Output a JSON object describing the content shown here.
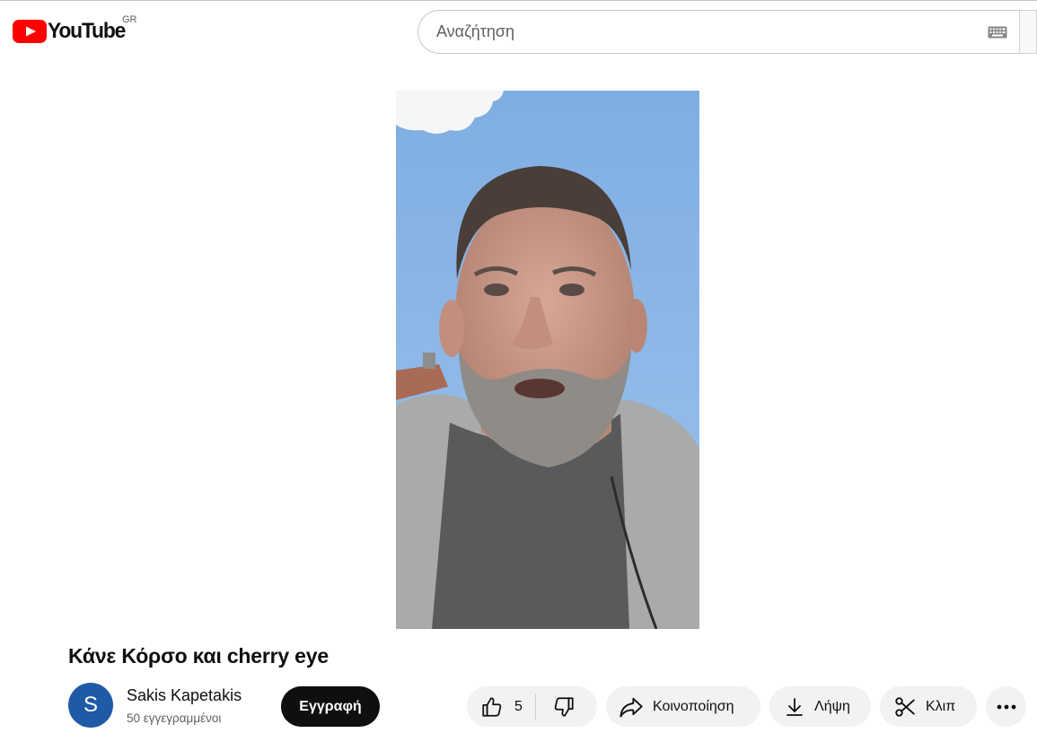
{
  "header": {
    "logo_text": "YouTube",
    "country_code": "GR",
    "search_placeholder": "Αναζήτηση"
  },
  "video": {
    "title": "Κάνε Κόρσο και cherry eye"
  },
  "channel": {
    "avatar_letter": "S",
    "name": "Sakis Kapetakis",
    "subscribers": "50 εγγεγραμμένοι"
  },
  "actions": {
    "subscribe_label": "Εγγραφή",
    "like_count": "5",
    "share_label": "Κοινοποίηση",
    "download_label": "Λήψη",
    "clip_label": "Κλιπ"
  },
  "colors": {
    "brand_red": "#ff0000",
    "avatar_blue": "#1f5aa6",
    "subscribe_bg": "#0f0f0f",
    "pill_bg": "#f2f2f2"
  },
  "icons": [
    "youtube-logo-icon",
    "keyboard-icon",
    "thumb-up-icon",
    "thumb-down-icon",
    "share-icon",
    "download-icon",
    "scissors-icon",
    "more-icon"
  ]
}
